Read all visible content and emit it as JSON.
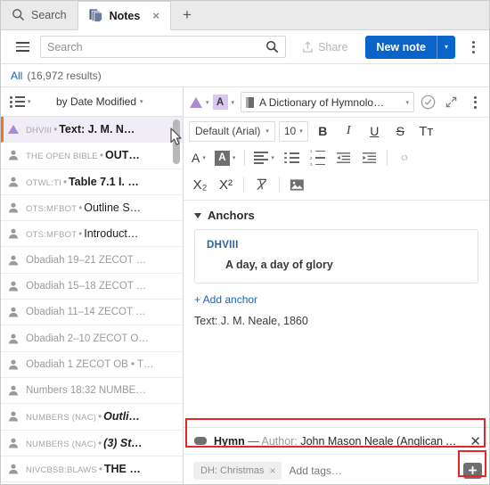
{
  "tabs": [
    {
      "label": "Search",
      "icon": "search-icon",
      "active": false
    },
    {
      "label": "Notes",
      "icon": "notes-stack-icon",
      "active": true,
      "close": "×"
    }
  ],
  "new_tab_label": "+",
  "toolbar": {
    "menu_icon": "hamburger-icon",
    "search_placeholder": "Search",
    "search_value": "",
    "search_icon": "search-icon",
    "share_label": "Share",
    "share_icon": "share-upload-icon",
    "new_note_label": "New note",
    "new_note_arrow": "▾",
    "overflow_icon": "kebab-menu-icon"
  },
  "results": {
    "filter_label": "All",
    "count_label": "(16,972 results)"
  },
  "list_header": {
    "view_icon": "list-view-icon",
    "view_caret": "▾",
    "sort_label": "by Date Modified",
    "sort_caret": "▾"
  },
  "notes": [
    {
      "prefix": "DHVIII",
      "title": "Text: J. M. N…",
      "style": "bold",
      "icon": "triangle-icon",
      "selected": true
    },
    {
      "prefix": "THE OPEN BIBLE",
      "title": "OUT…",
      "style": "bold",
      "icon": "person-icon",
      "selected": false
    },
    {
      "prefix": "OTWL:TI",
      "title": "Table 7.1 I. …",
      "style": "bold",
      "icon": "person-icon",
      "selected": false
    },
    {
      "prefix": "OTS:MFBOT",
      "title": "Outline S…",
      "style": "plain",
      "icon": "person-icon",
      "selected": false
    },
    {
      "prefix": "OTS:MFBOT",
      "title": "Introduct…",
      "style": "plain",
      "icon": "person-icon",
      "selected": false
    },
    {
      "prefix": "",
      "title": "Obadiah 19–21 ZECOT …",
      "style": "grey",
      "icon": "person-icon",
      "selected": false
    },
    {
      "prefix": "",
      "title": "Obadiah 15–18 ZECOT …",
      "style": "grey",
      "icon": "person-icon",
      "selected": false
    },
    {
      "prefix": "",
      "title": "Obadiah 11–14 ZECOT …",
      "style": "grey",
      "icon": "person-icon",
      "selected": false
    },
    {
      "prefix": "",
      "title": "Obadiah 2–10 ZECOT O…",
      "style": "grey",
      "icon": "person-icon",
      "selected": false
    },
    {
      "prefix": "",
      "title": "Obadiah 1 ZECOT OB • T…",
      "style": "grey",
      "icon": "person-icon",
      "selected": false
    },
    {
      "prefix": "",
      "title": "Numbers 18:32 NUMBE…",
      "style": "grey",
      "icon": "person-icon",
      "selected": false
    },
    {
      "prefix": "NUMBERS (NAC)",
      "title": "Outli…",
      "style": "bolditalic",
      "icon": "person-icon",
      "selected": false
    },
    {
      "prefix": "NUMBERS (NAC)",
      "title": "(3) St…",
      "style": "bolditalic",
      "icon": "person-icon",
      "selected": false
    },
    {
      "prefix": "NIVCBSB:BLAWS",
      "title": "THE …",
      "style": "bold",
      "icon": "person-icon",
      "selected": false
    }
  ],
  "note_header": {
    "note_color_icon": "purple-triangle-icon",
    "note_color_caret": "▾",
    "highlight_icon": "text-color-a-icon",
    "highlight_caret": "▾",
    "book_icon": "book-icon",
    "book_name": "A Dictionary of Hymnolo…",
    "book_caret": "▾",
    "check_icon": "check-circle-icon",
    "expand_icon": "expand-diagonal-icon",
    "overflow_icon": "kebab-menu-icon"
  },
  "format_toolbar": {
    "font_family": "Default (Arial)",
    "font_caret": "▾",
    "font_size": "10",
    "size_caret": "▾",
    "bold": "B",
    "italic": "I",
    "underline": "U",
    "strikethrough": "S",
    "text_style": "Tᴛ",
    "font_color": "A",
    "font_color_caret": "▾",
    "highlight_color": "A",
    "highlight_caret": "▾",
    "align_icon": "align-left-icon",
    "align_caret": "▾",
    "bullet_list_icon": "bullet-list-icon",
    "numbered_list_icon": "numbered-list-icon",
    "outdent_icon": "outdent-icon",
    "indent_icon": "indent-icon",
    "link_icon": "link-icon",
    "subscript": "X₂",
    "superscript": "X²",
    "clear_format_icon": "clear-formatting-icon",
    "image_icon": "insert-image-icon"
  },
  "anchors": {
    "section_label": "Anchors",
    "collapse_caret": "▾",
    "code": "DHVIII",
    "reference": "A day, a day of glory",
    "add_label": "+ Add anchor"
  },
  "note_body": {
    "text": "Text: J. M. Neale, 1860"
  },
  "hymn_bar": {
    "tag_icon": "label-pill-icon",
    "name": "Hymn",
    "dash": "—",
    "field_label": "Author:",
    "field_value": "John Mason Neale (Anglican Aut…",
    "close_icon": "close-x-icon",
    "close_glyph": "✕"
  },
  "tags_bar": {
    "chip_label": "DH: Christmas",
    "chip_remove": "×",
    "add_placeholder": "Add tags…",
    "add_value": "",
    "add_button_icon": "add-plus-button-icon",
    "add_button_glyph": "➕"
  },
  "colors": {
    "accent_blue": "#0a63c9",
    "link_blue": "#1565c0",
    "selected_row_bg": "#f1edf7",
    "selected_row_marker": "#e07a2e",
    "annotation_red": "#e8262a",
    "purple_triangle": "#a98ad4"
  }
}
